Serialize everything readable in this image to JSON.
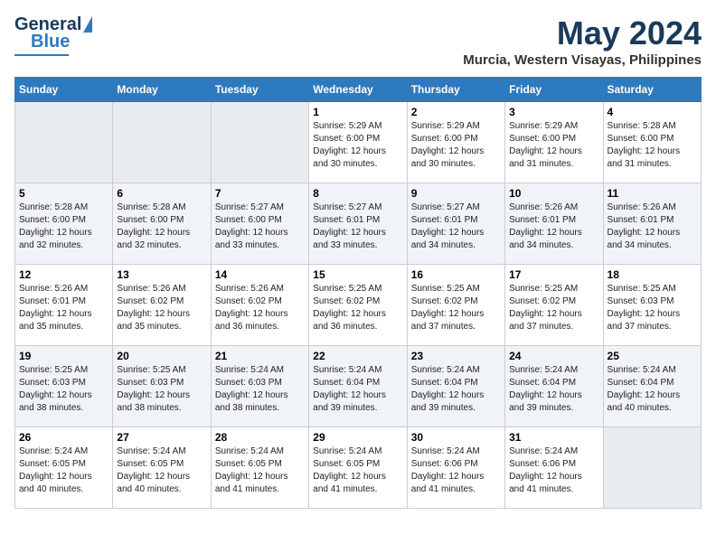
{
  "logo": {
    "general": "General",
    "blue": "Blue"
  },
  "header": {
    "title": "May 2024",
    "subtitle": "Murcia, Western Visayas, Philippines"
  },
  "weekdays": [
    "Sunday",
    "Monday",
    "Tuesday",
    "Wednesday",
    "Thursday",
    "Friday",
    "Saturday"
  ],
  "weeks": [
    [
      {
        "day": "",
        "info": ""
      },
      {
        "day": "",
        "info": ""
      },
      {
        "day": "",
        "info": ""
      },
      {
        "day": "1",
        "info": "Sunrise: 5:29 AM\nSunset: 6:00 PM\nDaylight: 12 hours\nand 30 minutes."
      },
      {
        "day": "2",
        "info": "Sunrise: 5:29 AM\nSunset: 6:00 PM\nDaylight: 12 hours\nand 30 minutes."
      },
      {
        "day": "3",
        "info": "Sunrise: 5:29 AM\nSunset: 6:00 PM\nDaylight: 12 hours\nand 31 minutes."
      },
      {
        "day": "4",
        "info": "Sunrise: 5:28 AM\nSunset: 6:00 PM\nDaylight: 12 hours\nand 31 minutes."
      }
    ],
    [
      {
        "day": "5",
        "info": "Sunrise: 5:28 AM\nSunset: 6:00 PM\nDaylight: 12 hours\nand 32 minutes."
      },
      {
        "day": "6",
        "info": "Sunrise: 5:28 AM\nSunset: 6:00 PM\nDaylight: 12 hours\nand 32 minutes."
      },
      {
        "day": "7",
        "info": "Sunrise: 5:27 AM\nSunset: 6:00 PM\nDaylight: 12 hours\nand 33 minutes."
      },
      {
        "day": "8",
        "info": "Sunrise: 5:27 AM\nSunset: 6:01 PM\nDaylight: 12 hours\nand 33 minutes."
      },
      {
        "day": "9",
        "info": "Sunrise: 5:27 AM\nSunset: 6:01 PM\nDaylight: 12 hours\nand 34 minutes."
      },
      {
        "day": "10",
        "info": "Sunrise: 5:26 AM\nSunset: 6:01 PM\nDaylight: 12 hours\nand 34 minutes."
      },
      {
        "day": "11",
        "info": "Sunrise: 5:26 AM\nSunset: 6:01 PM\nDaylight: 12 hours\nand 34 minutes."
      }
    ],
    [
      {
        "day": "12",
        "info": "Sunrise: 5:26 AM\nSunset: 6:01 PM\nDaylight: 12 hours\nand 35 minutes."
      },
      {
        "day": "13",
        "info": "Sunrise: 5:26 AM\nSunset: 6:02 PM\nDaylight: 12 hours\nand 35 minutes."
      },
      {
        "day": "14",
        "info": "Sunrise: 5:26 AM\nSunset: 6:02 PM\nDaylight: 12 hours\nand 36 minutes."
      },
      {
        "day": "15",
        "info": "Sunrise: 5:25 AM\nSunset: 6:02 PM\nDaylight: 12 hours\nand 36 minutes."
      },
      {
        "day": "16",
        "info": "Sunrise: 5:25 AM\nSunset: 6:02 PM\nDaylight: 12 hours\nand 37 minutes."
      },
      {
        "day": "17",
        "info": "Sunrise: 5:25 AM\nSunset: 6:02 PM\nDaylight: 12 hours\nand 37 minutes."
      },
      {
        "day": "18",
        "info": "Sunrise: 5:25 AM\nSunset: 6:03 PM\nDaylight: 12 hours\nand 37 minutes."
      }
    ],
    [
      {
        "day": "19",
        "info": "Sunrise: 5:25 AM\nSunset: 6:03 PM\nDaylight: 12 hours\nand 38 minutes."
      },
      {
        "day": "20",
        "info": "Sunrise: 5:25 AM\nSunset: 6:03 PM\nDaylight: 12 hours\nand 38 minutes."
      },
      {
        "day": "21",
        "info": "Sunrise: 5:24 AM\nSunset: 6:03 PM\nDaylight: 12 hours\nand 38 minutes."
      },
      {
        "day": "22",
        "info": "Sunrise: 5:24 AM\nSunset: 6:04 PM\nDaylight: 12 hours\nand 39 minutes."
      },
      {
        "day": "23",
        "info": "Sunrise: 5:24 AM\nSunset: 6:04 PM\nDaylight: 12 hours\nand 39 minutes."
      },
      {
        "day": "24",
        "info": "Sunrise: 5:24 AM\nSunset: 6:04 PM\nDaylight: 12 hours\nand 39 minutes."
      },
      {
        "day": "25",
        "info": "Sunrise: 5:24 AM\nSunset: 6:04 PM\nDaylight: 12 hours\nand 40 minutes."
      }
    ],
    [
      {
        "day": "26",
        "info": "Sunrise: 5:24 AM\nSunset: 6:05 PM\nDaylight: 12 hours\nand 40 minutes."
      },
      {
        "day": "27",
        "info": "Sunrise: 5:24 AM\nSunset: 6:05 PM\nDaylight: 12 hours\nand 40 minutes."
      },
      {
        "day": "28",
        "info": "Sunrise: 5:24 AM\nSunset: 6:05 PM\nDaylight: 12 hours\nand 41 minutes."
      },
      {
        "day": "29",
        "info": "Sunrise: 5:24 AM\nSunset: 6:05 PM\nDaylight: 12 hours\nand 41 minutes."
      },
      {
        "day": "30",
        "info": "Sunrise: 5:24 AM\nSunset: 6:06 PM\nDaylight: 12 hours\nand 41 minutes."
      },
      {
        "day": "31",
        "info": "Sunrise: 5:24 AM\nSunset: 6:06 PM\nDaylight: 12 hours\nand 41 minutes."
      },
      {
        "day": "",
        "info": ""
      }
    ]
  ]
}
